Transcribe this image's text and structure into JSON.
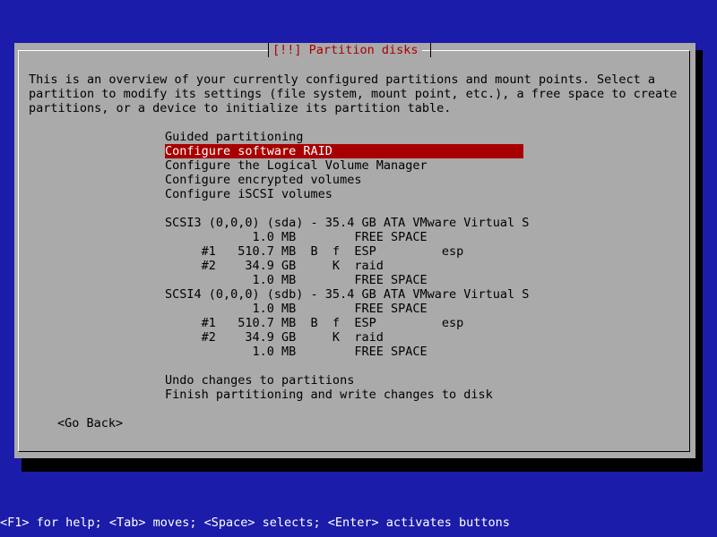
{
  "dialog": {
    "title": "[!!] Partition disks",
    "intro": [
      "This is an overview of your currently configured partitions and mount points. Select a",
      "partition to modify its settings (file system, mount point, etc.), a free space to create",
      "partitions, or a device to initialize its partition table."
    ],
    "menu": [
      "Guided partitioning",
      "Configure software RAID",
      "Configure the Logical Volume Manager",
      "Configure encrypted volumes",
      "Configure iSCSI volumes"
    ],
    "partitions": [
      "SCSI3 (0,0,0) (sda) - 35.4 GB ATA VMware Virtual S",
      "            1.0 MB        FREE SPACE",
      "     #1   510.7 MB  B  f  ESP         esp",
      "     #2    34.9 GB     K  raid",
      "            1.0 MB        FREE SPACE",
      "SCSI4 (0,0,0) (sdb) - 35.4 GB ATA VMware Virtual S",
      "            1.0 MB        FREE SPACE",
      "     #1   510.7 MB  B  f  ESP         esp",
      "     #2    34.9 GB     K  raid",
      "            1.0 MB        FREE SPACE"
    ],
    "actions": [
      "Undo changes to partitions",
      "Finish partitioning and write changes to disk"
    ],
    "go_back": "<Go Back>"
  },
  "status_bar": "<F1> for help; <Tab> moves; <Space> selects; <Enter> activates buttons",
  "colors": {
    "background": "#1c1caa",
    "dialog": "#aaaaaa",
    "highlight": "#a80000",
    "title": "#a80000"
  }
}
